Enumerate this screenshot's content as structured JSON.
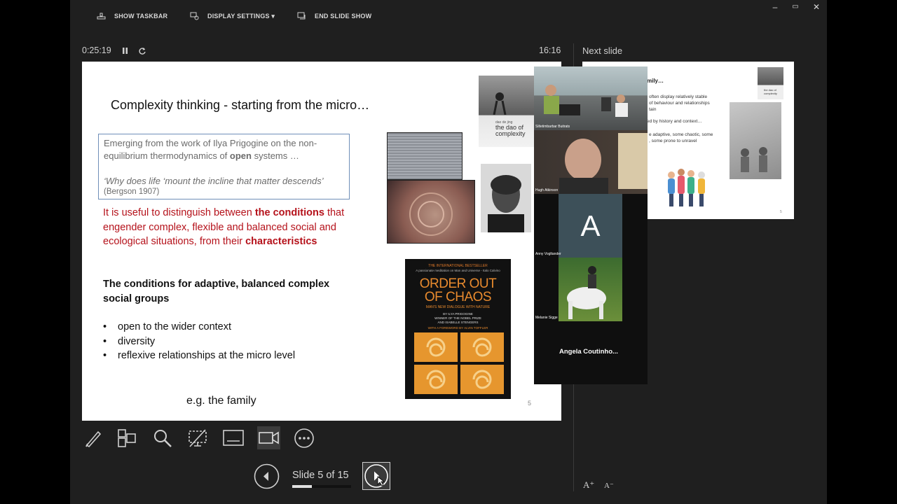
{
  "toolbar": {
    "show_taskbar": "SHOW TASKBAR",
    "display_settings": "DISPLAY SETTINGS ▾",
    "end_slide_show": "END SLIDE SHOW"
  },
  "window": {
    "minimize": "–",
    "restore": "▭",
    "close": "✕"
  },
  "presenter": {
    "elapsed": "0:25:19",
    "clock": "16:16",
    "next_slide_label": "Next slide",
    "slide_counter": "Slide 5 of 15",
    "progress_fraction": 0.333
  },
  "slide": {
    "title": "Complexity thinking -  starting from the micro…",
    "quote_line1": "Emerging from the work of Ilya Prigogine on the non-",
    "quote_line2_pre": "equilibrium thermodynamics of ",
    "quote_line2_bold": "open",
    "quote_line2_post": " systems …",
    "quote_italic": "‘Why does life ‘mount the incline that matter descends’",
    "quote_source": "(Bergson 1907)",
    "red_pre": "It is useful to distinguish between ",
    "red_bold1": "the conditions",
    "red_mid": "that engender complex, flexible and balanced social and ecological situations, from their",
    "red_bold2": "characteristics",
    "conditions_heading": "The conditions for adaptive, balanced complex social groups",
    "bullets": [
      "open to the wider context",
      "diversity",
      "reflexive relationships at the micro level"
    ],
    "example": "e.g. the family",
    "page_number": "5",
    "book1": {
      "top": "dao de jing",
      "title": "the dao of complexity"
    },
    "book2": {
      "tag": "THE INTERNATIONAL BESTSELLER",
      "blurb": "A passionate meditation on Man and Universe - Italo Calvino",
      "title_line1": "ORDER OUT",
      "title_line2": "OF CHAOS",
      "subtitle": "MAN'S NEW DIALOGUE WITH NATURE",
      "authors1": "BY ILYA PRIGOGINE",
      "authors2": "WINNER OF THE NOBEL PRIZE",
      "authors3": "AND ISABELLE STENGERS",
      "foreword": "WITH A FOREWORD BY ALVIN TOFFLER"
    }
  },
  "next_slide": {
    "line1": "mily…",
    "line2": "often display relatively stable",
    "line3": "of behaviour and relationships",
    "line4": "tain",
    "line5": "ed by history and context…",
    "line6": "e adaptive, some chaotic, some",
    "line7": ", some prone to unravel",
    "page_number": "5",
    "book_title": "the dao of complexity"
  },
  "participants": [
    {
      "name": "Siltetimbarbar Buitrats"
    },
    {
      "name": "Hugh Atkinson"
    },
    {
      "name": "Anny Vogltander",
      "initial": "A"
    },
    {
      "name": "Melanie Sigge"
    },
    {
      "name": "Angela  Coutinho..."
    }
  ],
  "font_controls": {
    "increase": "A⁺",
    "decrease": "A⁻"
  },
  "colors": {
    "accent_red": "#b5121b",
    "slide_bg": "#ffffff",
    "stage_bg": "#1f1f1f",
    "avatar_bg": "#3d5059"
  }
}
